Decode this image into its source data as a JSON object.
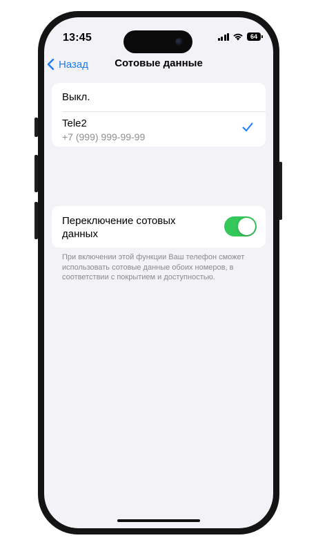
{
  "status_bar": {
    "time": "13:45",
    "battery": "64",
    "icons": [
      "signal-icon",
      "wifi-icon",
      "battery-icon"
    ]
  },
  "nav": {
    "back_label": "Назад",
    "title": "Сотовые данные"
  },
  "sim_options": {
    "off_label": "Выкл.",
    "carrier": "Tele2",
    "number": "+7 (999) 999-99-99",
    "selected": "Tele2"
  },
  "switching": {
    "label": "Переключение сотовых данных",
    "enabled": true,
    "footnote": "При включении этой функции Ваш телефон сможет использовать сотовые данные обоих номеров, в соответствии с покрытием и доступностью."
  },
  "colors": {
    "accent": "#1a7cf5",
    "toggle_on": "#34c759",
    "background": "#f2f2f7"
  }
}
